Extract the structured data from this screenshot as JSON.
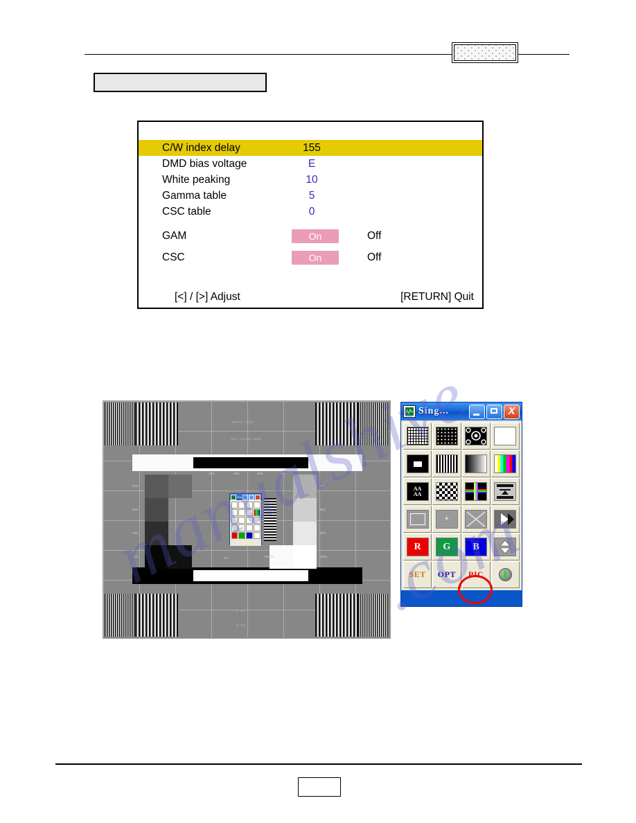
{
  "header": {
    "badge_label": "",
    "title_box_label": ""
  },
  "osd": {
    "rows": [
      {
        "label": "C/W index delay",
        "value": "155",
        "highlight": true
      },
      {
        "label": "DMD bias voltage",
        "value": "E",
        "highlight": false
      },
      {
        "label": "White peaking",
        "value": "10",
        "highlight": false
      },
      {
        "label": "Gamma table",
        "value": "5",
        "highlight": false
      },
      {
        "label": "CSC table",
        "value": "0",
        "highlight": false
      }
    ],
    "toggles": [
      {
        "label": "GAM",
        "on_label": "On",
        "off_label": "Off",
        "selected": "On"
      },
      {
        "label": "CSC",
        "on_label": "On",
        "off_label": "Off",
        "selected": "On"
      }
    ],
    "footer_left": "[<] / [>] Adjust",
    "footer_right": "[RETURN] Quit",
    "colors": {
      "highlight_bar": "#e5cb05",
      "value_text": "#4b21c0",
      "toggle_on": "#eb9cb6"
    }
  },
  "test_pattern": {
    "title": "SMPTE TEST",
    "revision": "Rev. 141109 1998",
    "bottom_h": "H 128",
    "bottom_v": "V 102",
    "percent_top": [
      "40%",
      "50%",
      "60%",
      "6%"
    ],
    "percent_left": [
      "30%",
      "30%",
      "10%",
      "0%"
    ],
    "percent_right": [
      "70%",
      "80%",
      "90%",
      "100%"
    ],
    "center_label_a": "0%",
    "center_label_b": "100 0%"
  },
  "app_window": {
    "title": "Sing...",
    "icon": "waveform-icon",
    "minimize_label": "",
    "maximize_label": "",
    "close_label": "X",
    "buttons": [
      {
        "name": "grid-pattern",
        "icon": "grid-icon"
      },
      {
        "name": "dot-pattern",
        "icon": "dots-icon"
      },
      {
        "name": "circle-pattern",
        "icon": "circles-icon"
      },
      {
        "name": "white-field",
        "icon": "white-box-icon"
      },
      {
        "name": "window-box-pattern",
        "icon": "white-rect-on-black-icon"
      },
      {
        "name": "vertical-bars",
        "icon": "vertical-bars-icon"
      },
      {
        "name": "grayscale-ramp",
        "icon": "gradient-icon"
      },
      {
        "name": "color-bars",
        "icon": "color-bars-icon"
      },
      {
        "name": "character-pattern",
        "icon": "letter-a-icon",
        "text": "AA"
      },
      {
        "name": "checkerboard",
        "icon": "checkerboard-icon"
      },
      {
        "name": "color-crosshatch",
        "icon": "color-cross-icon"
      },
      {
        "name": "monoscope",
        "icon": "monoscope-icon"
      },
      {
        "name": "blank-raster",
        "icon": "gray-rect-icon"
      },
      {
        "name": "crosshair",
        "icon": "plus-icon",
        "text": "+"
      },
      {
        "name": "diagonal-cross",
        "icon": "x-cross-icon"
      },
      {
        "name": "motion-test",
        "icon": "play-triangle-icon"
      },
      {
        "name": "red-field",
        "icon": "red-field-icon",
        "text": "R"
      },
      {
        "name": "green-field",
        "icon": "green-field-icon",
        "text": "G"
      },
      {
        "name": "blue-field",
        "icon": "blue-field-icon",
        "text": "B"
      },
      {
        "name": "updown-arrows",
        "icon": "diamond-arrows-icon"
      }
    ],
    "bottom_row": {
      "set_label": "SET",
      "opt_label": "OPT",
      "pic_label": "PIC",
      "led_name": "status-led"
    },
    "colors": {
      "titlebar": "#1565d8",
      "set_text": "#cc7a1a",
      "opt_text": "#1a1a9e",
      "pic_text": "#ee1111",
      "annotation_circle": "#ee0000"
    }
  },
  "watermark": {
    "line1": "manualshive",
    "line2": ".com"
  },
  "footer": {
    "page_box_label": ""
  }
}
